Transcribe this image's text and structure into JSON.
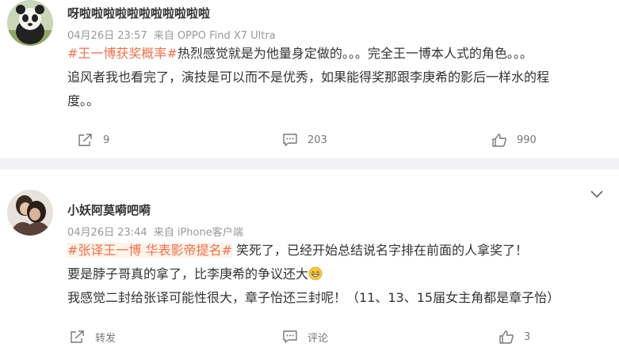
{
  "posts": [
    {
      "username": "呀啦啦啦啦啦啦啦啦啦啦啦",
      "date": "04月26日 23:57",
      "source": "来自 OPPO Find X7 Ultra",
      "hashtag": "#王一博获奖概率#",
      "lines": [
        "热烈感觉就是为他量身定做的。。。完全王一博本人式的角色。。。",
        "追风者我也看完了，演技是可以而不是优秀，如果能得奖那跟李庚希的影后一样水的程",
        "度。。"
      ],
      "share": "9",
      "comment": "203",
      "like": "990"
    },
    {
      "username": "小妖阿莫嗬吧嗬",
      "date": "04月26日 23:44",
      "source": "来自 iPhone客户端",
      "hashtag": "#张译王一博 华表影帝提名#",
      "lines": [
        " 笑死了，已经开始总结说名字排在前面的人拿奖了！",
        "要是脖子哥真的拿了，比李庚希的争议还大",
        "我感觉二封给张译可能性很大，章子怡还三封呢！（11、13、15届女主角都是章子怡）"
      ],
      "share": "转发",
      "comment": "评论",
      "like": "3"
    }
  ],
  "icons": {
    "share": "share-icon",
    "comment": "comment-icon",
    "like": "thumbs-up-icon",
    "more": "chevron-down-icon",
    "emoji": "grinning-emoji"
  },
  "colors": {
    "hashtag": "#eb7350",
    "meta": "#999999",
    "text": "#333333",
    "separator": "#f2f2f5"
  }
}
